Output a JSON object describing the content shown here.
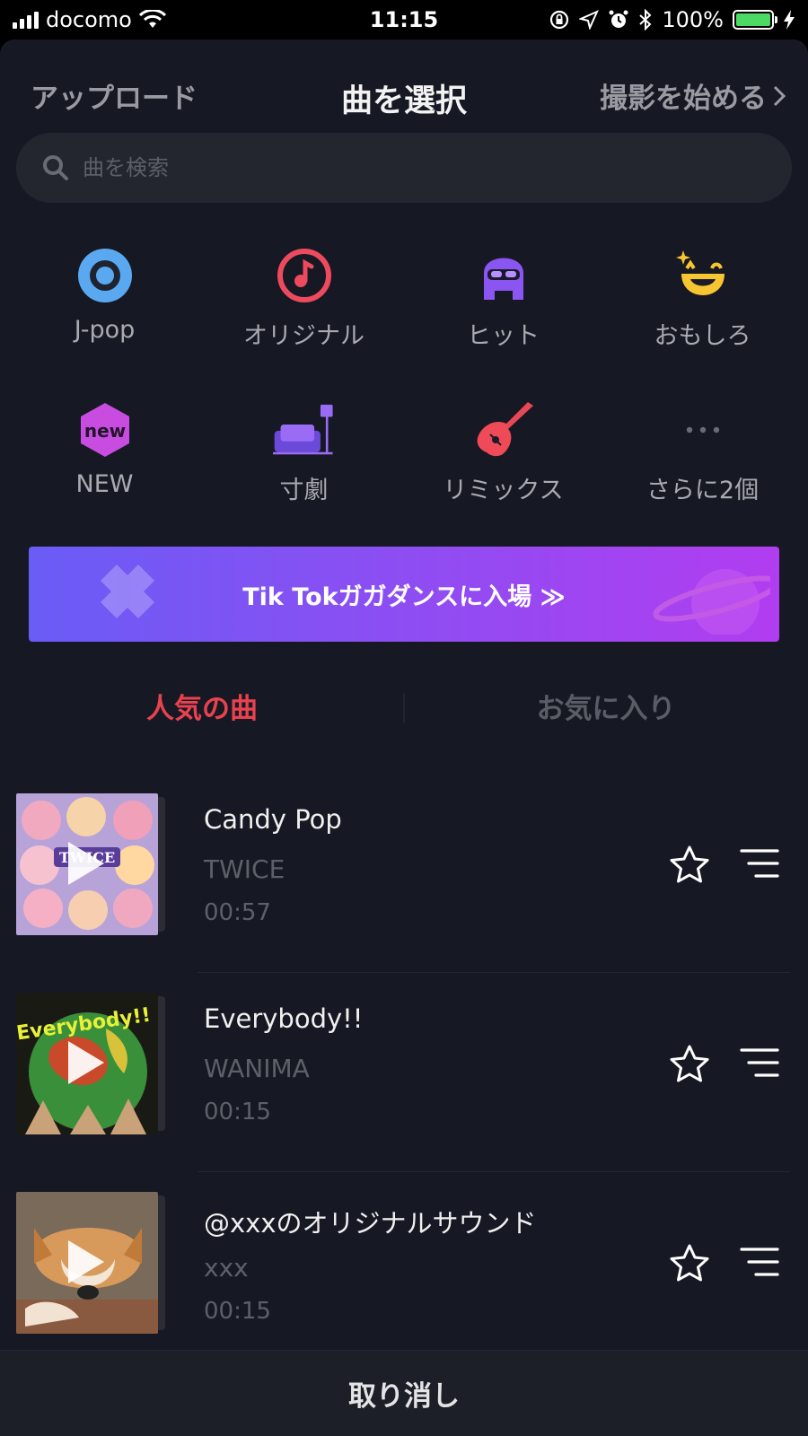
{
  "status_bar": {
    "carrier": "docomo",
    "time": "11:15",
    "battery": "100%"
  },
  "header": {
    "upload": "アップロード",
    "title": "曲を選択",
    "start": "撮影を始める"
  },
  "search": {
    "placeholder": "曲を検索"
  },
  "categories": [
    {
      "label": "J-pop",
      "icon": "disc-icon"
    },
    {
      "label": "オリジナル",
      "icon": "music-note-icon"
    },
    {
      "label": "ヒット",
      "icon": "sunglasses-person-icon"
    },
    {
      "label": "おもしろ",
      "icon": "laughing-face-icon"
    },
    {
      "label": "NEW",
      "icon": "new-badge-icon"
    },
    {
      "label": "寸劇",
      "icon": "sofa-lamp-icon"
    },
    {
      "label": "リミックス",
      "icon": "guitar-icon"
    },
    {
      "label": "さらに2個",
      "icon": "more-dots-icon"
    }
  ],
  "new_badge_text": "new",
  "banner": {
    "text": "Tik Tokガガダンスに入場 ≫"
  },
  "tabs": {
    "popular": "人気の曲",
    "favorites": "お気に入り"
  },
  "songs": [
    {
      "title": "Candy Pop",
      "artist": "TWICE",
      "duration": "00:57"
    },
    {
      "title": "Everybody!!",
      "artist": "WANIMA",
      "duration": "00:15"
    },
    {
      "title": "@xxxのオリジナルサウンド",
      "artist": "xxx",
      "duration": "00:15"
    }
  ],
  "cover_texts": {
    "cover0": "TWICE",
    "cover1": "Everybody!!"
  },
  "footer": {
    "cancel": "取り消し"
  },
  "colors": {
    "accent": "#e8424f",
    "background": "#161823",
    "banner_start": "#6a5cf6",
    "banner_end": "#b13df0"
  }
}
